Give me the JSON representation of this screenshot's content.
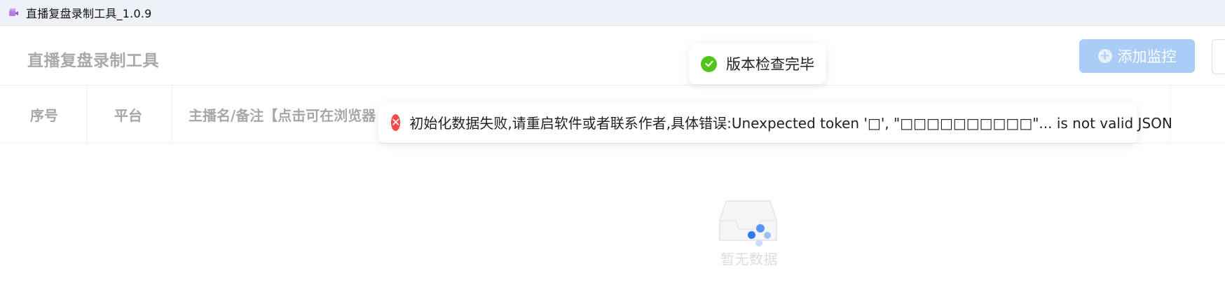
{
  "window": {
    "title": "直播复盘录制工具_1.0.9"
  },
  "header": {
    "app_name": "直播复盘录制工具",
    "add_button_label": "添加监控"
  },
  "table": {
    "columns": [
      "序号",
      "平台",
      "主播名/备注【点击可在浏览器"
    ]
  },
  "empty_state": {
    "text": "暂无数据"
  },
  "notifications": {
    "success": "版本检查完毕",
    "error": "初始化数据失败,请重启软件或者联系作者,具体错误:Unexpected token '□', \"□□□□□□□□□□\"... is not valid JSON"
  },
  "icons": {
    "title_icon": "camera-icon",
    "plus_icon": "plus-circle-icon",
    "success_icon": "check-circle-icon",
    "error_icon": "close-circle-icon",
    "empty_icon": "inbox-icon",
    "loading_icon": "spinner-icon"
  },
  "colors": {
    "accent": "#a9cdf7",
    "success": "#52c41a",
    "error": "#f14c4c"
  }
}
